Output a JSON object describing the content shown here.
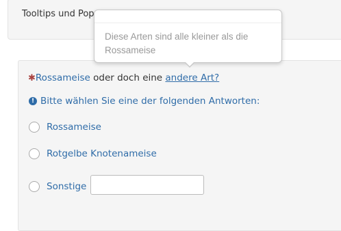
{
  "top_panel": {
    "title": "Tooltips und Pop"
  },
  "question": {
    "required_marker": "✱",
    "term": "Rossameise",
    "connector": " oder doch eine ",
    "link_text": "andere Art?",
    "hint_icon": "!",
    "hint_text": "Bitte wählen Sie eine der folgenden Antworten:"
  },
  "options": [
    {
      "label": "Rossameise"
    },
    {
      "label": "Rotgelbe Knotenameise"
    },
    {
      "label": "Sonstige"
    }
  ],
  "other_input": {
    "value": ""
  },
  "popover": {
    "body": "Diese Arten sind alle kleiner als die Rossameise"
  },
  "colors": {
    "accent": "#2f6ca8",
    "required": "#a94442",
    "panel_bg": "#f5f5f5",
    "muted_text": "#999999"
  }
}
